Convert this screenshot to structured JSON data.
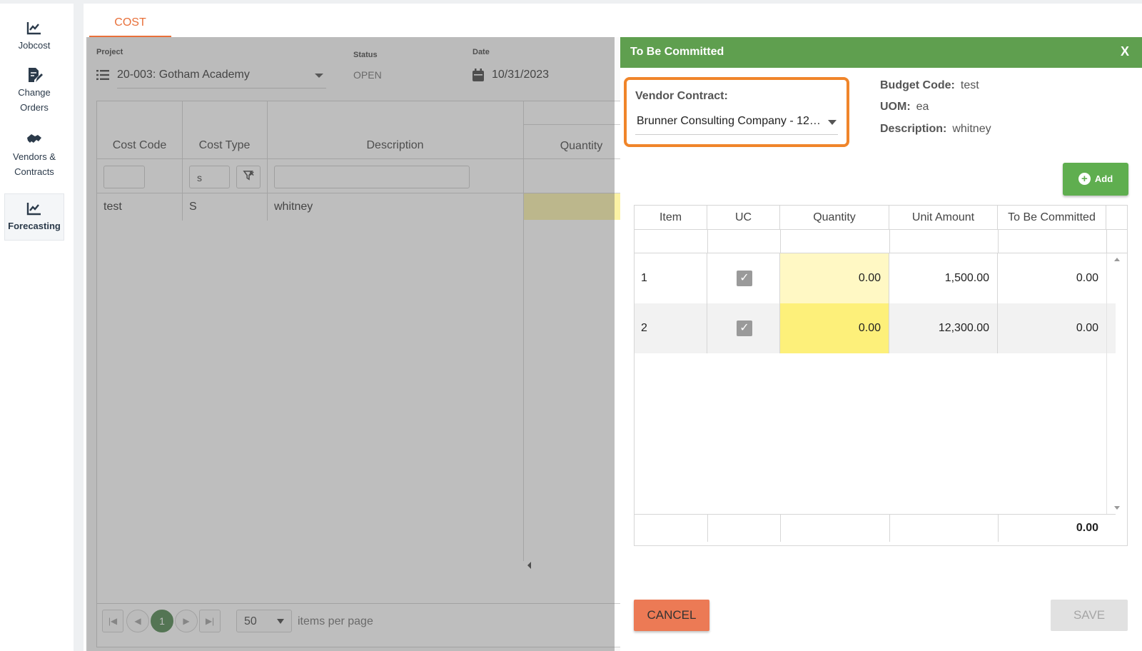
{
  "sidebar": {
    "items": [
      {
        "label1": "Jobcost",
        "label2": "",
        "icon": "chart-line-icon"
      },
      {
        "label1": "Change",
        "label2": "Orders",
        "icon": "edit-document-icon"
      },
      {
        "label1": "Vendors &",
        "label2": "Contracts",
        "icon": "handshake-icon"
      },
      {
        "label1": "Forecasting",
        "label2": "",
        "icon": "chart-line-icon"
      }
    ]
  },
  "tab": {
    "label": "COST"
  },
  "header": {
    "project_label": "Project",
    "project_value": "20-003: Gotham Academy",
    "status_label": "Status",
    "status_value": "OPEN",
    "date_label": "Date",
    "date_value": "10/31/2023"
  },
  "grid": {
    "columns": [
      "Cost Code",
      "Cost Type",
      "Description",
      "Quantity"
    ],
    "filters": {
      "cost_code": "",
      "cost_type": "s",
      "description": ""
    },
    "rows": [
      {
        "cost_code": "test",
        "cost_type": "S",
        "description": "whitney"
      }
    ]
  },
  "pager": {
    "current_page": "1",
    "page_size": "50",
    "per_page_label": "items per page"
  },
  "panel": {
    "title": "To Be Committed",
    "close_label": "X",
    "vendor_contract_label": "Vendor Contract:",
    "vendor_contract_value": "Brunner Consulting Company - 12…",
    "budget_code_label": "Budget Code:",
    "budget_code_value": "test",
    "uom_label": "UOM:",
    "uom_value": "ea",
    "description_label": "Description:",
    "description_value": "whitney",
    "add_label": "Add",
    "columns": [
      "Item",
      "UC",
      "Quantity",
      "Unit Amount",
      "To Be Committed"
    ],
    "rows": [
      {
        "item": "1",
        "uc": true,
        "quantity": "0.00",
        "unit_amount": "1,500.00",
        "to_be_committed": "0.00"
      },
      {
        "item": "2",
        "uc": true,
        "quantity": "0.00",
        "unit_amount": "12,300.00",
        "to_be_committed": "0.00"
      }
    ],
    "total": "0.00",
    "cancel_label": "CANCEL",
    "save_label": "SAVE"
  },
  "colors": {
    "accent_orange": "#e8703a",
    "panel_green": "#5f9f4f",
    "highlight_border": "#f0852a",
    "quantity_cell_light": "#fff8c4",
    "quantity_cell_strong": "#fdf07a"
  }
}
